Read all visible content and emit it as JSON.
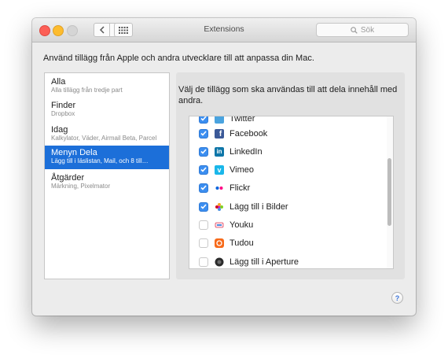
{
  "window": {
    "title": "Extensions"
  },
  "search": {
    "placeholder": "Sök"
  },
  "heading": "Använd tillägg från Apple och andra utvecklare till att anpassa din Mac.",
  "sidebar": {
    "items": [
      {
        "title": "Alla",
        "subtitle": "Alla tillägg från tredje part",
        "selected": false
      },
      {
        "title": "Finder",
        "subtitle": "Dropbox",
        "selected": false
      },
      {
        "title": "Idag",
        "subtitle": "Kalkylator, Väder, Airmail Beta, Parcel",
        "selected": false
      },
      {
        "title": "Menyn Dela",
        "subtitle": "Lägg till i läslistan, Mail, och 8 till…",
        "selected": true
      },
      {
        "title": "Åtgärder",
        "subtitle": "Märkning, Pixelmator",
        "selected": false
      }
    ]
  },
  "panel": {
    "description": "Välj de tillägg som ska användas till att dela innehåll med andra.",
    "extensions": [
      {
        "label": "Twitter",
        "checked": true,
        "icon": "twitter-icon"
      },
      {
        "label": "Facebook",
        "checked": true,
        "icon": "facebook-icon"
      },
      {
        "label": "LinkedIn",
        "checked": true,
        "icon": "linkedin-icon"
      },
      {
        "label": "Vimeo",
        "checked": true,
        "icon": "vimeo-icon"
      },
      {
        "label": "Flickr",
        "checked": true,
        "icon": "flickr-icon"
      },
      {
        "label": "Lägg till i Bilder",
        "checked": true,
        "icon": "photos-icon"
      },
      {
        "label": "Youku",
        "checked": false,
        "icon": "youku-icon"
      },
      {
        "label": "Tudou",
        "checked": false,
        "icon": "tudou-icon"
      },
      {
        "label": "Lägg till i Aperture",
        "checked": false,
        "icon": "aperture-icon"
      }
    ]
  },
  "help": {
    "label": "?"
  },
  "colors": {
    "accent": "#1c6fd9",
    "checkbox": "#3b8ef0"
  }
}
